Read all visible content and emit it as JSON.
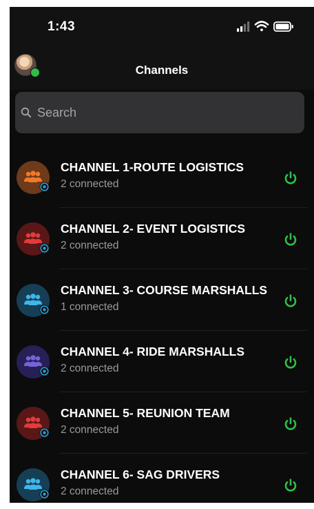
{
  "status_bar": {
    "time": "1:43",
    "icons": [
      "cellular-signal-icon",
      "wifi-icon",
      "battery-icon"
    ]
  },
  "header": {
    "title": "Channels",
    "avatar": "user-avatar",
    "avatar_status_color": "#2fbf49"
  },
  "search": {
    "placeholder": "Search",
    "icon": "search-icon"
  },
  "colors": {
    "background": "#0c0c0c",
    "bar": "#121212",
    "search_box": "#323234",
    "power_green": "#2fbf49",
    "badge_blue": "#2a9fd6",
    "secondary_text": "#9a9a9a"
  },
  "channels": [
    {
      "name": "CHANNEL 1-ROUTE LOGISTICS",
      "status": "2 connected",
      "avatar_bg": "#6e3a1a",
      "icon_color": "#f07a2a",
      "icon": "group-icon",
      "action_icon": "power-icon"
    },
    {
      "name": "CHANNEL 2- EVENT LOGISTICS",
      "status": "2 connected",
      "avatar_bg": "#5a1717",
      "icon_color": "#e23b3b",
      "icon": "group-icon",
      "action_icon": "power-icon"
    },
    {
      "name": "CHANNEL 3- COURSE MARSHALLS",
      "status": "1 connected",
      "avatar_bg": "#163f55",
      "icon_color": "#3fb6ea",
      "icon": "group-icon",
      "action_icon": "power-icon"
    },
    {
      "name": "CHANNEL 4- RIDE MARSHALLS",
      "status": "2 connected",
      "avatar_bg": "#262056",
      "icon_color": "#7563d8",
      "icon": "group-icon",
      "action_icon": "power-icon"
    },
    {
      "name": "CHANNEL 5- REUNION TEAM",
      "status": "2 connected",
      "avatar_bg": "#5a1717",
      "icon_color": "#e23b3b",
      "icon": "group-icon",
      "action_icon": "power-icon"
    },
    {
      "name": "CHANNEL 6- SAG DRIVERS",
      "status": "2 connected",
      "avatar_bg": "#163f55",
      "icon_color": "#3fb6ea",
      "icon": "group-icon",
      "action_icon": "power-icon"
    }
  ]
}
